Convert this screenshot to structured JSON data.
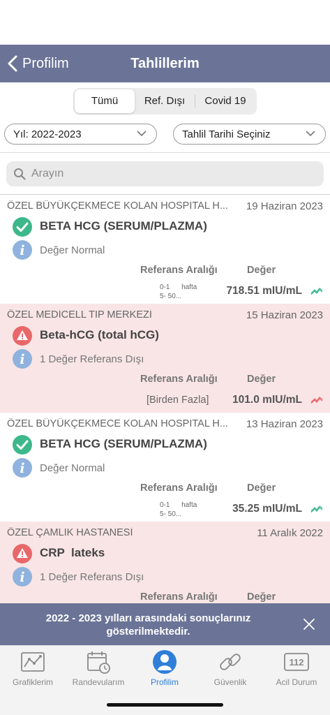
{
  "nav": {
    "back_label": "Profilim",
    "title": "Tahlillerim"
  },
  "segments": [
    {
      "label": "Tümü",
      "active": true
    },
    {
      "label": "Ref. Dışı",
      "active": false
    },
    {
      "label": "Covid 19",
      "active": false
    }
  ],
  "filters": {
    "year": "Yıl: 2022-2023",
    "date": "Tahlil Tarihi Seçiniz"
  },
  "search": {
    "placeholder": "Arayın",
    "value": ""
  },
  "results": [
    {
      "hospital": "ÖZEL BÜYÜKÇEKMECE KOLAN HOSPİTAL H...",
      "date": "19 Haziran 2023",
      "status": "normal",
      "test": "BETA HCG (SERUM/PLAZMA)",
      "status_text": "Değer Normal",
      "ref_header": "Referans Aralığı",
      "value_header": "Değer",
      "ref_line1": "0-1      hafta",
      "ref_line2": "5- 50...",
      "ref_text": "",
      "value": "718.51 mIU/mL"
    },
    {
      "hospital": "ÖZEL MEDİCELL TIP MERKEZİ",
      "date": "15 Haziran 2023",
      "status": "abnormal",
      "test": "Beta-hCG (total hCG)",
      "status_text": "1 Değer Referans Dışı",
      "ref_header": "Referans Aralığı",
      "value_header": "Değer",
      "ref_line1": "",
      "ref_line2": "",
      "ref_text": "[Birden Fazla]",
      "value": "101.0 mIU/mL"
    },
    {
      "hospital": "ÖZEL BÜYÜKÇEKMECE KOLAN HOSPİTAL H...",
      "date": "13 Haziran 2023",
      "status": "normal",
      "test": "BETA HCG (SERUM/PLAZMA)",
      "status_text": "Değer Normal",
      "ref_header": "Referans Aralığı",
      "value_header": "Değer",
      "ref_line1": "0-1      hafta",
      "ref_line2": "5- 50...",
      "ref_text": "",
      "value": "35.25 mIU/mL"
    },
    {
      "hospital": "ÖZEL ÇAMLIK HASTANESİ",
      "date": "11 Aralık 2022",
      "status": "abnormal",
      "test": "CRP  lateks",
      "status_text": "1 Değer Referans Dışı",
      "ref_header": "Referans Aralığı",
      "value_header": "Değer",
      "ref_line1": "",
      "ref_line2": "",
      "ref_text": "",
      "value": ""
    }
  ],
  "toast": {
    "message": "2022 - 2023 yılları arasındaki sonuçlarınız gösterilmektedir."
  },
  "tabs": [
    {
      "label": "Grafiklerim",
      "icon": "chart-icon",
      "active": false
    },
    {
      "label": "Randevularım",
      "icon": "calendar-icon",
      "active": false
    },
    {
      "label": "Profilim",
      "icon": "profile-icon",
      "active": true
    },
    {
      "label": "Güvenlik",
      "icon": "link-icon",
      "active": false
    },
    {
      "label": "Acil Durum",
      "icon": "emergency-112-icon",
      "active": false
    },
    {
      "badge": "112"
    }
  ],
  "colors": {
    "nav_bg": "#6b7497",
    "normal_green": "#3db88a",
    "abnormal_red": "#e8686a",
    "abnormal_bg": "#f9e5e5",
    "info_blue": "#8fb2de",
    "tab_active": "#2f7fd9"
  }
}
